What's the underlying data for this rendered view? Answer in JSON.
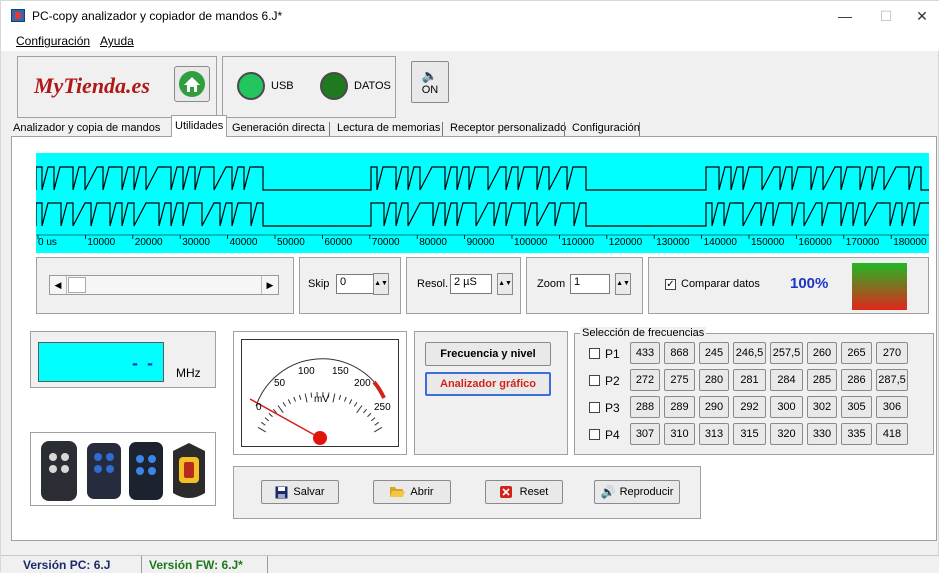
{
  "window": {
    "title": "PC-copy analizador y copiador de mandos 6.J*",
    "minimize": "—",
    "maximize": "☐",
    "close": "✕"
  },
  "menu": {
    "items": [
      "Configuración",
      "Ayuda"
    ]
  },
  "header": {
    "brand": "MyTienda.es",
    "usb_label": "USB",
    "datos_label": "DATOS",
    "sound_label": "ON",
    "usb_color": "#22c55e",
    "datos_color": "#1f7a1f"
  },
  "tabs": [
    "Analizador y copia de mandos",
    "Utilidades",
    "Generación directa",
    "Lectura de memorias",
    "Receptor personalizado",
    "Configuración"
  ],
  "active_tab": "Utilidades",
  "waveform": {
    "axis_labels": [
      "0 us",
      "10000",
      "20000",
      "30000",
      "40000",
      "50000",
      "60000",
      "70000",
      "80000",
      "90000",
      "100000",
      "110000",
      "120000",
      "130000",
      "140000",
      "150000",
      "160000",
      "170000",
      "180000"
    ],
    "background_color": "#00ffff"
  },
  "controls": {
    "skip_label": "Skip",
    "skip_value": "0",
    "resol_label": "Resol.",
    "resol_value": "2 µS",
    "zoom_label": "Zoom",
    "zoom_value": "1",
    "compare_label": "Comparar datos",
    "compare_checked": true,
    "percent": "100%"
  },
  "frequency_display": {
    "value": "- -",
    "unit": "MHz"
  },
  "gauge": {
    "scale": [
      "0",
      "50",
      "100",
      "150",
      "200",
      "250"
    ],
    "unit": "mV",
    "level": 0.0
  },
  "mode_buttons": {
    "freq_level": "Frecuencia y nivel",
    "graph_analyzer": "Analizador gráfico"
  },
  "freq_selection": {
    "title": "Selección de frecuencias",
    "rows": [
      {
        "label": "P1",
        "values": [
          "433",
          "868",
          "245",
          "246,5",
          "257,5",
          "260",
          "265",
          "270"
        ]
      },
      {
        "label": "P2",
        "values": [
          "272",
          "275",
          "280",
          "281",
          "284",
          "285",
          "286",
          "287,5"
        ]
      },
      {
        "label": "P3",
        "values": [
          "288",
          "289",
          "290",
          "292",
          "300",
          "302",
          "305",
          "306"
        ]
      },
      {
        "label": "P4",
        "values": [
          "307",
          "310",
          "313",
          "315",
          "320",
          "330",
          "335",
          "418"
        ]
      }
    ]
  },
  "actions": {
    "save": "Salvar",
    "open": "Abrir",
    "reset": "Reset",
    "play": "Reproducir"
  },
  "status": {
    "pc_version": "Versión PC: 6.J",
    "fw_version": "Versión FW: 6.J*"
  }
}
